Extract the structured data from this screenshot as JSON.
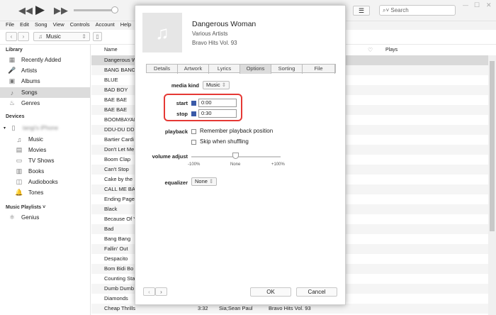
{
  "toolbar": {
    "prev_icon": "rewind-icon",
    "play_icon": "play-icon",
    "next_icon": "fast-forward-icon",
    "search_placeholder": "Search",
    "volume_fraction": 0.85
  },
  "menu": [
    "File",
    "Edit",
    "Song",
    "View",
    "Controls",
    "Account",
    "Help"
  ],
  "nav": {
    "media_selector": "Music"
  },
  "sidebar": {
    "library_title": "Library",
    "library": [
      {
        "label": "Recently Added",
        "icon": "calendar-grid-icon"
      },
      {
        "label": "Artists",
        "icon": "microphone-icon"
      },
      {
        "label": "Albums",
        "icon": "album-icon"
      },
      {
        "label": "Songs",
        "icon": "note-icon"
      },
      {
        "label": "Genres",
        "icon": "genres-icon"
      }
    ],
    "devices_title": "Devices",
    "device_name": "tangi's iPhone",
    "device_items": [
      {
        "label": "Music"
      },
      {
        "label": "Movies"
      },
      {
        "label": "TV Shows"
      },
      {
        "label": "Books"
      },
      {
        "label": "Audiobooks"
      },
      {
        "label": "Tones"
      }
    ],
    "playlists_title": "Music Playlists ˅",
    "playlists": [
      {
        "label": "Genius"
      }
    ]
  },
  "list": {
    "col_name": "Name",
    "col_plays": "Plays",
    "rows": [
      "Dangerous W",
      "BANG BANG",
      "BLUE",
      "BAD BOY",
      "BAE BAE",
      "BAE BAE",
      "BOOMBAYAH",
      "DDU-DU DD",
      "Bartier Cardi",
      "Don't Let Me",
      "Boom Clap",
      "Can't Stop",
      "Cake by the",
      "CALL ME BA",
      "Ending Page",
      "Black",
      "Because Of Y",
      "Bad",
      "Bang Bang",
      "Fallin' Out",
      "Despacito",
      "Bom Bidi Bo",
      "Counting Sta",
      "Dumb Dumb",
      "Diamonds",
      "Cheap Thrills"
    ],
    "last_row": {
      "time": "3:32",
      "artist": "Sia;Sean Paul",
      "album": "Bravo Hits Vol. 93"
    }
  },
  "dialog": {
    "title": "Dangerous Woman",
    "artist": "Various Artists",
    "album": "Bravo Hits Vol. 93",
    "tabs": [
      "Details",
      "Artwork",
      "Lyrics",
      "Options",
      "Sorting",
      "File"
    ],
    "active_tab": "Options",
    "media_kind_label": "media kind",
    "media_kind": "Music",
    "start_label": "start",
    "start": "0:00",
    "start_checked": true,
    "stop_label": "stop",
    "stop": "0:30",
    "stop_checked": true,
    "playback_label": "playback",
    "remember": "Remember playback position",
    "skip": "Skip when shuffling",
    "volume_label": "volume adjust",
    "vol_min": "-100%",
    "vol_mid": "None",
    "vol_max": "+100%",
    "volume_value": 0,
    "eq_label": "equalizer",
    "eq": "None",
    "ok": "OK",
    "cancel": "Cancel",
    "highlight_color": "#e53935"
  }
}
